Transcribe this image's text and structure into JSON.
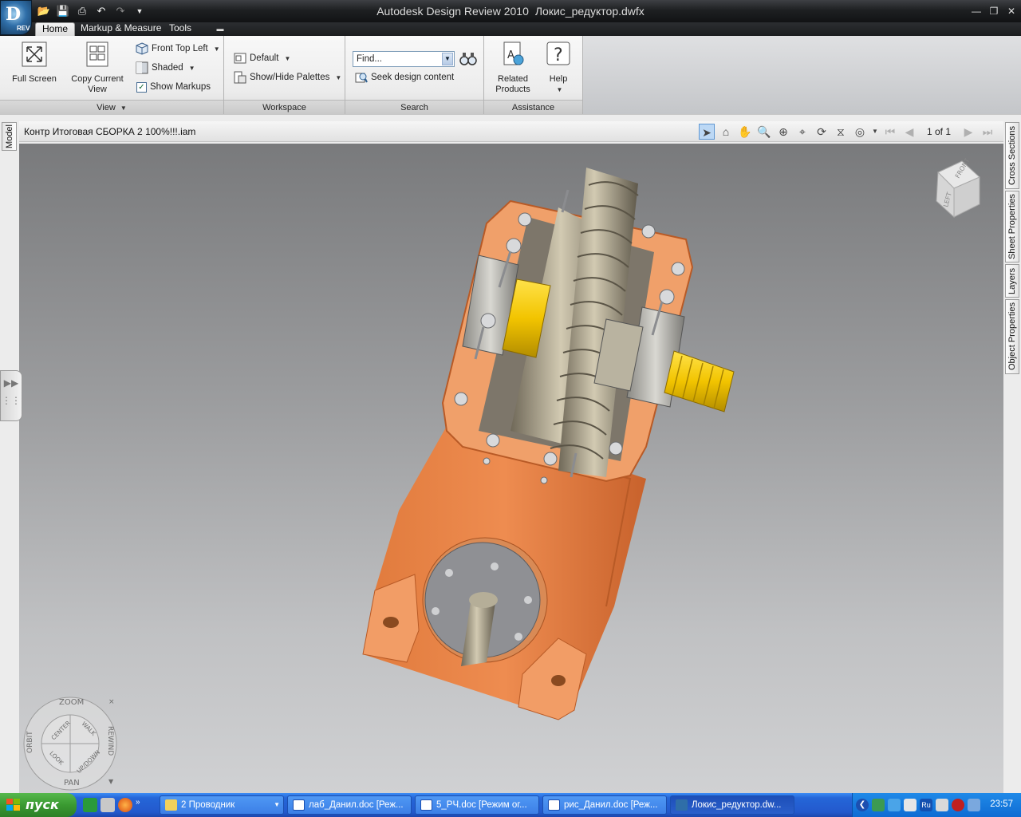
{
  "window": {
    "app_title": "Autodesk Design Review 2010",
    "file_title": "Локис_редуктор.dwfx",
    "app_button_badge": "REV"
  },
  "ribbon": {
    "tabs": [
      "Home",
      "Markup & Measure",
      "Tools"
    ],
    "active_tab": "Home",
    "panels": {
      "view": {
        "label": "View",
        "full_screen": "Full Screen",
        "copy_current_view": "Copy Current View",
        "view_orientation": "Front Top Left",
        "display_mode": "Shaded",
        "show_markups": "Show Markups",
        "show_markups_checked": true
      },
      "workspace": {
        "label": "Workspace",
        "workspace_select": "Default",
        "show_hide_palettes": "Show/Hide Palettes"
      },
      "search": {
        "label": "Search",
        "find_placeholder": "Find...",
        "seek_design_content": "Seek design content"
      },
      "assistance": {
        "label": "Assistance",
        "related_products": "Related Products",
        "help": "Help"
      }
    }
  },
  "document": {
    "sheet_name": "Контр Итоговая СБОРКА 2 100%!!!.iam",
    "page_indicator": "1 of 1"
  },
  "left_tabs": [
    "Model"
  ],
  "right_tabs": [
    "Cross Sections",
    "Sheet Properties",
    "Layers",
    "Object Properties"
  ],
  "viewcube": {
    "face_front": "FRONT",
    "face_left": "LEFT"
  },
  "steering_wheel": {
    "zoom": "ZOOM",
    "orbit": "ORBIT",
    "rewind": "REWIND",
    "pan": "PAN",
    "center": "CENTER",
    "walk": "WALK",
    "look": "LOOK",
    "updown": "UP/DOWN"
  },
  "taskbar": {
    "start_label": "пуск",
    "buttons": [
      {
        "label": "2 Проводник",
        "icon": "folder-icon",
        "active": false
      },
      {
        "label": "лаб_Данил.doc [Реж...",
        "icon": "word-icon",
        "active": false
      },
      {
        "label": "5_РЧ.doc [Режим ог...",
        "icon": "word-icon",
        "active": false
      },
      {
        "label": "рис_Данил.doc [Реж...",
        "icon": "word-icon",
        "active": false
      },
      {
        "label": "Локис_редуктор.dw...",
        "icon": "design-review-icon",
        "active": true
      }
    ],
    "tray_language": "Ru",
    "clock": "23:57"
  },
  "colors": {
    "housing": "#e8844a",
    "housing_face": "#f2a36e",
    "shaft_yellow": "#f2c400",
    "gear_metal": "#bdb5a0",
    "titlebar": "#1e2022",
    "taskbar": "#2359cd",
    "start_green": "#3a9a31"
  }
}
